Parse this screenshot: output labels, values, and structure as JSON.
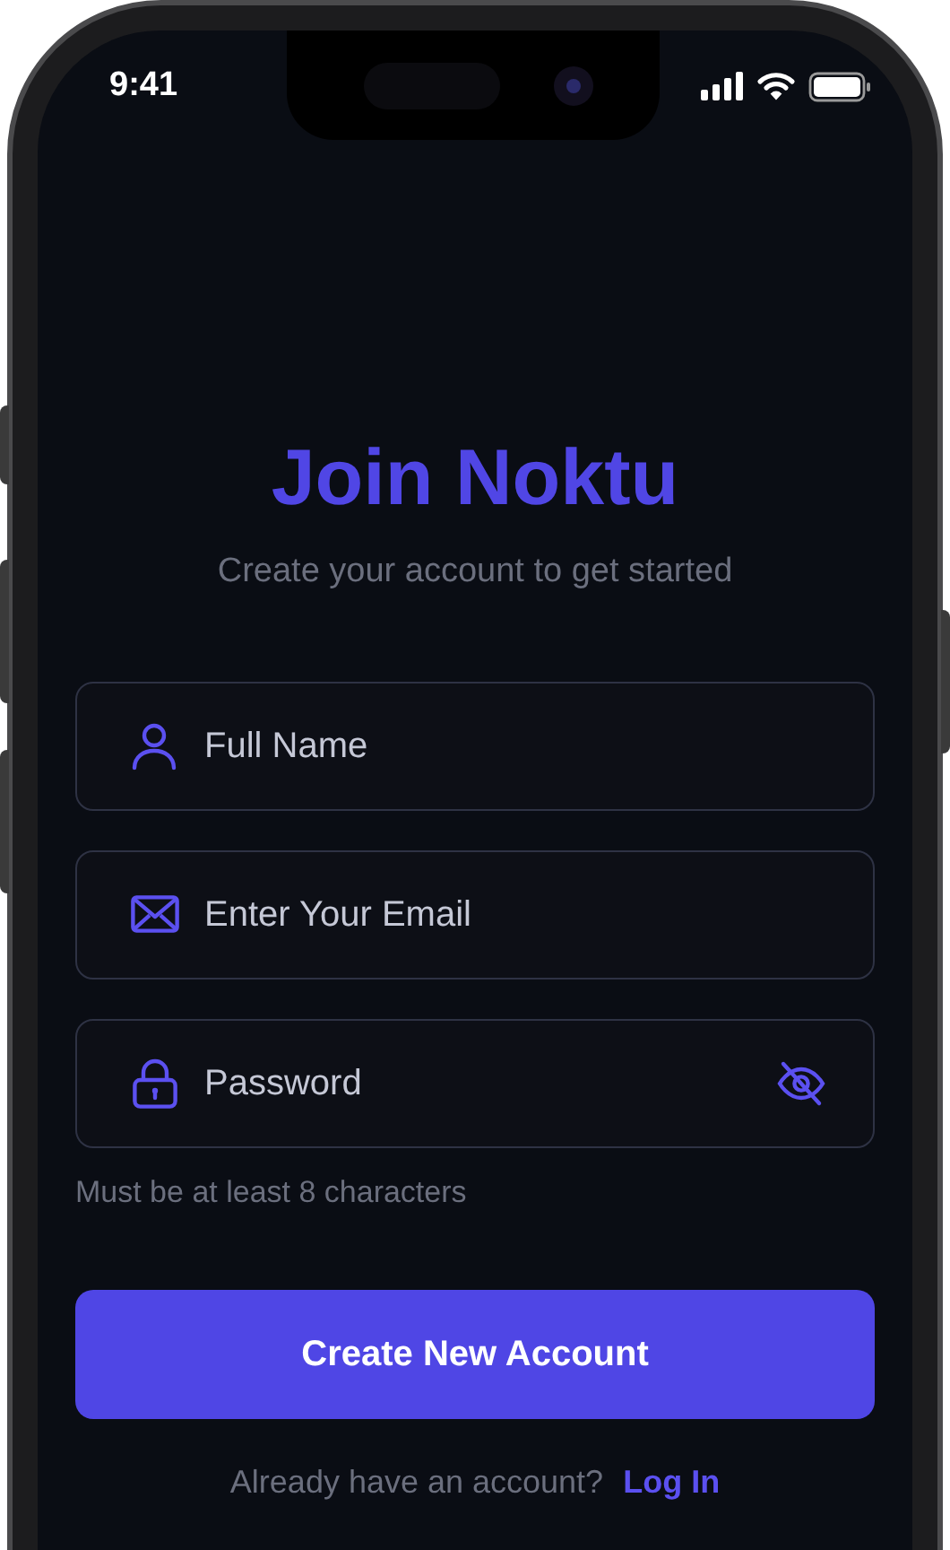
{
  "status_bar": {
    "time": "9:41"
  },
  "title": "Join Noktu",
  "subtitle": "Create your account to get started",
  "fields": [
    {
      "kind": "name",
      "placeholder": "Full Name"
    },
    {
      "kind": "email",
      "placeholder": "Enter Your Email"
    },
    {
      "kind": "password",
      "placeholder": "Password",
      "password_visible": false
    }
  ],
  "hint": "Must be at least 8 characters",
  "submit": "Create New Account",
  "footer": {
    "text": "Already have an account?",
    "link": "Log In"
  }
}
